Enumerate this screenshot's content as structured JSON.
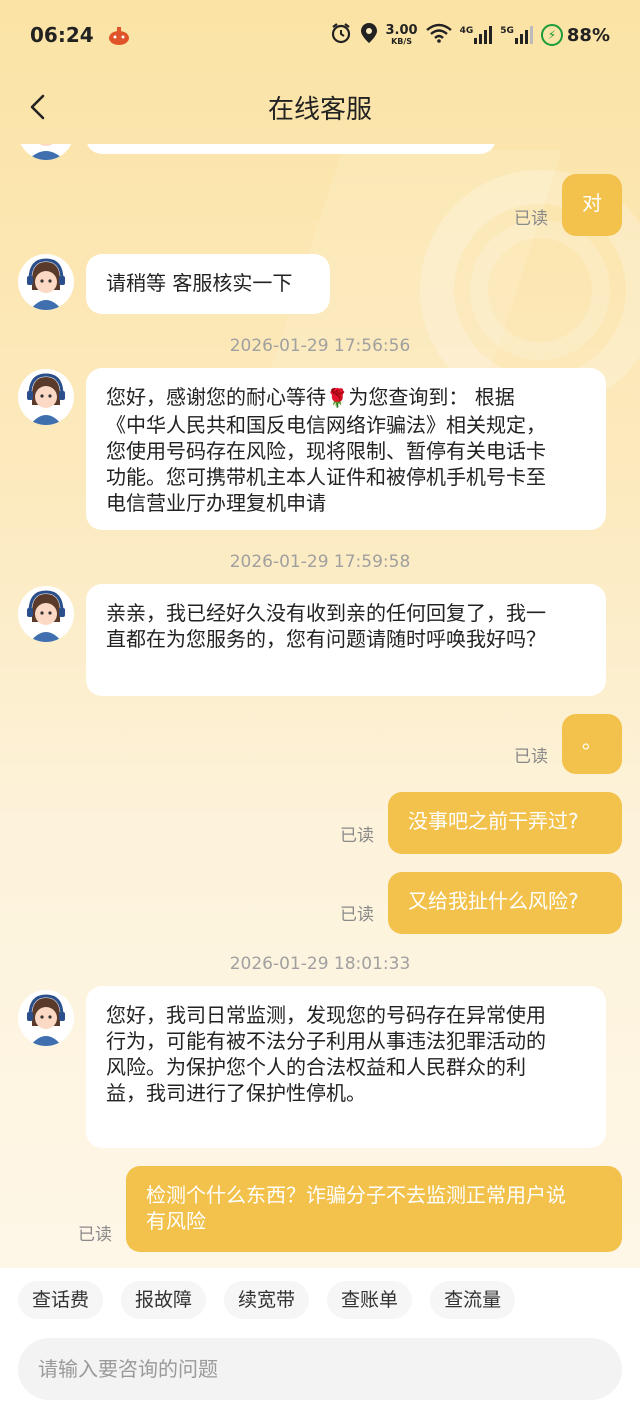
{
  "status": {
    "time": "06:24",
    "net_speed_value": "3.00",
    "net_speed_unit": "KB/S",
    "signal1": "4G",
    "signal2": "5G",
    "battery": "88%"
  },
  "header": {
    "title": "在线客服"
  },
  "messages": {
    "user_dui": "对",
    "read1": "已读",
    "agent_wait": "请稍等  客服核实一下",
    "ts1": "2026-01-29 17:56:56",
    "agent_info_l1": "您好，感谢您的耐心等待",
    "agent_info_emoji": "🌹",
    "agent_info_l1b": "为您查询到：  根据",
    "agent_info_l2": "《中华人民共和国反电信网络诈骗法》相关规定，",
    "agent_info_l3": "您使用号码存在风险，现将限制、暂停有关电话卡",
    "agent_info_l4": "功能。您可携带机主本人证件和被停机手机号卡至",
    "agent_info_l5": "电信营业厅办理复机申请",
    "ts2": "2026-01-29 17:59:58",
    "agent_qin_l1": "亲亲，我已经好久没有收到亲的任何回复了，我一",
    "agent_qin_l2": "直都在为您服务的，您有问题请随时呼唤我好吗？",
    "user_dot": "。",
    "read2": "已读",
    "user_q1": "没事吧之前干弄过?",
    "read3": "已读",
    "user_q2": "又给我扯什么风险?",
    "read4": "已读",
    "ts3": "2026-01-29 18:01:33",
    "agent_mon_l1": "您好，我司日常监测，发现您的号码存在异常使用",
    "agent_mon_l2": "行为，可能有被不法分子利用从事违法犯罪活动的",
    "agent_mon_l3": "风险。为保护您个人的合法权益和人民群众的利",
    "agent_mon_l4": "益，我司进行了保护性停机。",
    "user_q3_l1": "检测个什么东西？诈骗分子不去监测正常用户说",
    "user_q3_l2": "有风险",
    "read5": "已读"
  },
  "quick_replies": [
    "查话费",
    "报故障",
    "续宽带",
    "查账单",
    "查流量"
  ],
  "input": {
    "placeholder": "请输入要咨询的问题"
  },
  "colors": {
    "user_bubble": "#f2c24c",
    "agent_bubble": "#ffffff"
  }
}
